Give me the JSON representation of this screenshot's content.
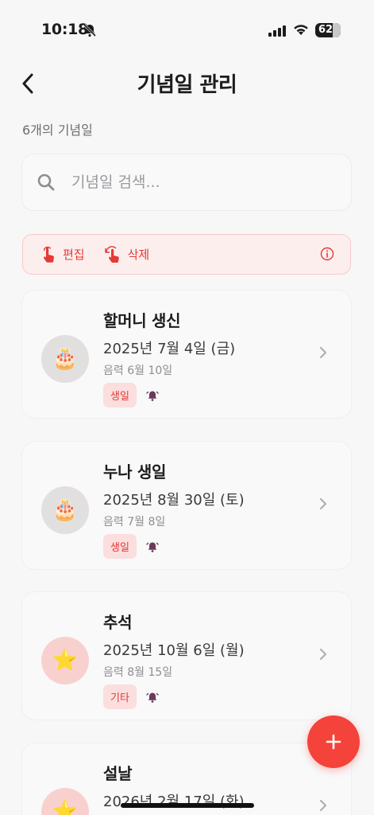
{
  "status_bar": {
    "time": "10:18",
    "battery": "62"
  },
  "header": {
    "title": "기념일 관리"
  },
  "count_text": "6개의 기념일",
  "search": {
    "placeholder": "기념일 검색..."
  },
  "hint": {
    "edit_label": "편집",
    "delete_label": "삭제"
  },
  "items": [
    {
      "title": "할머니 생신",
      "date": "2025년 7월 4일 (금)",
      "lunar": "음력 6월 10일",
      "tag": "생일",
      "icon": "birthday-cake",
      "avatar_color": "#e2dfdf"
    },
    {
      "title": "누나 생일",
      "date": "2025년 8월 30일 (토)",
      "lunar": "음력 7월 8일",
      "tag": "생일",
      "icon": "birthday-cake",
      "avatar_color": "#e2dfdf"
    },
    {
      "title": "추석",
      "date": "2025년 10월 6일 (월)",
      "lunar": "음력 8월 15일",
      "tag": "기타",
      "icon": "star",
      "avatar_color": "#f8d1cf"
    },
    {
      "title": "설날",
      "date": "2026년 2월 17일 (화)",
      "lunar": "",
      "tag": "",
      "icon": "star",
      "avatar_color": "#f8d1cf"
    }
  ],
  "colors": {
    "accent": "#f4433a",
    "tag_bg": "#fbdedd",
    "tag_text": "#e53935"
  }
}
